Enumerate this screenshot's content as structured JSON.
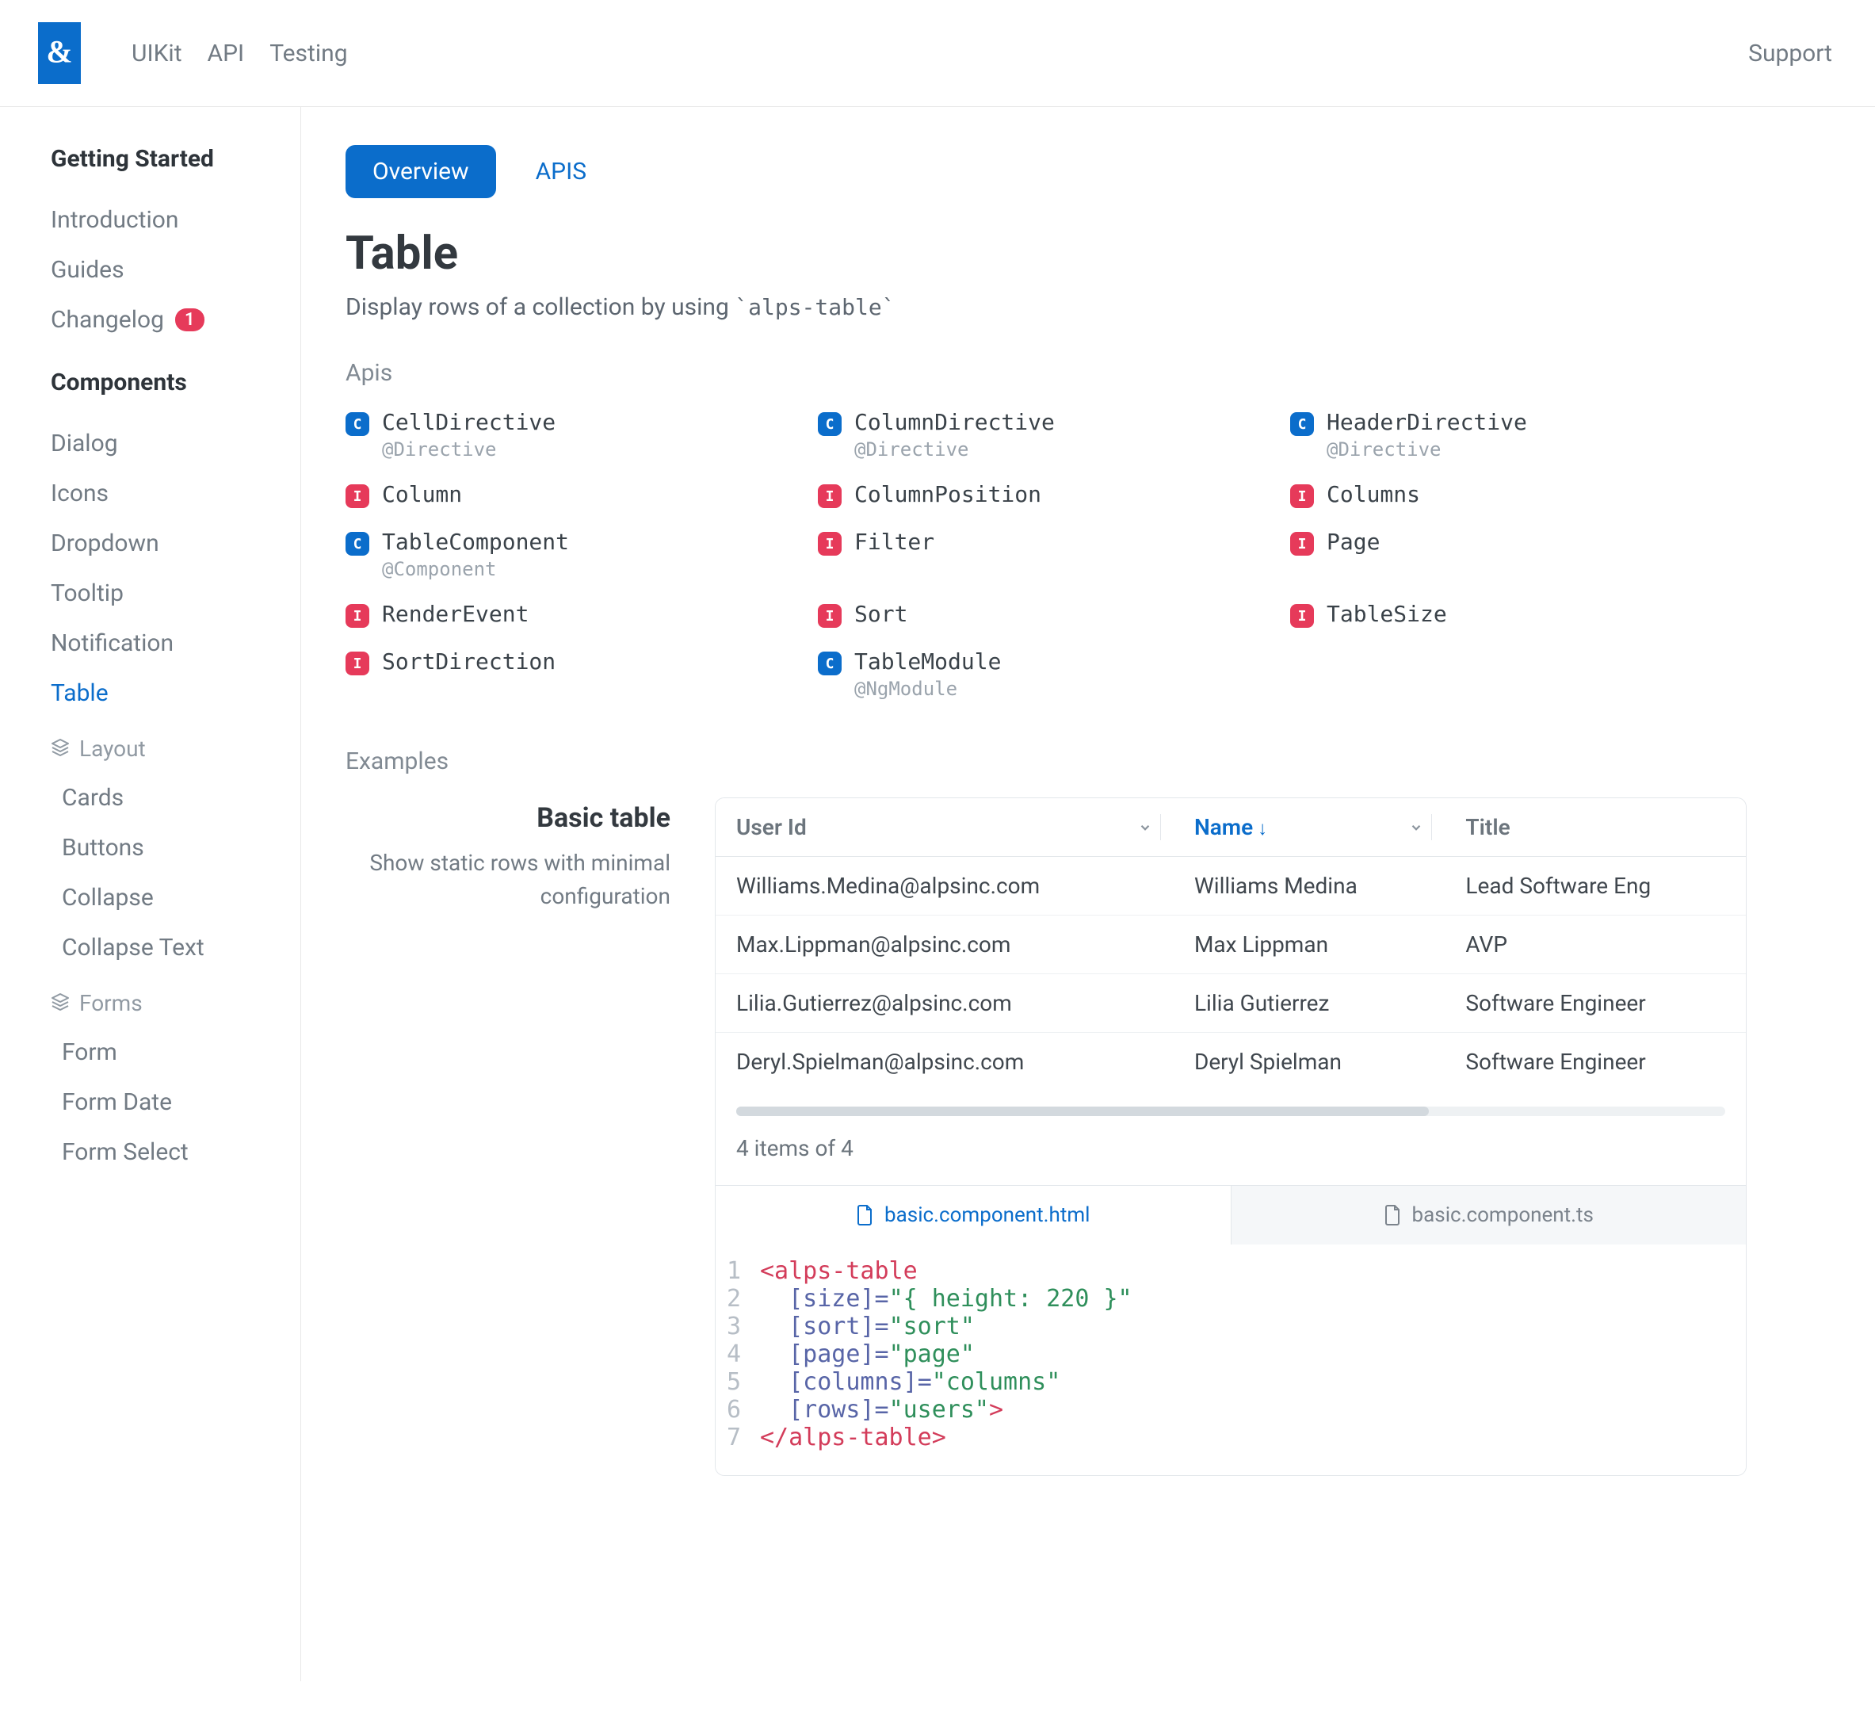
{
  "topnav": {
    "items": [
      "UIKit",
      "API",
      "Testing"
    ],
    "right": "Support"
  },
  "sidebar": {
    "sections": [
      {
        "title": "Getting Started",
        "items": [
          {
            "label": "Introduction"
          },
          {
            "label": "Guides"
          },
          {
            "label": "Changelog",
            "badge": "1"
          }
        ]
      },
      {
        "title": "Components",
        "items": [
          {
            "label": "Dialog"
          },
          {
            "label": "Icons"
          },
          {
            "label": "Dropdown"
          },
          {
            "label": "Tooltip"
          },
          {
            "label": "Notification"
          },
          {
            "label": "Table",
            "active": true
          }
        ],
        "groups": [
          {
            "label": "Layout",
            "items": [
              "Cards",
              "Buttons",
              "Collapse",
              "Collapse Text"
            ]
          },
          {
            "label": "Forms",
            "items": [
              "Form",
              "Form Date",
              "Form Select"
            ]
          }
        ]
      }
    ]
  },
  "tabs": {
    "active": "Overview",
    "other": "APIS"
  },
  "page": {
    "title": "Table",
    "desc_prefix": "Display rows of a collection by using ",
    "desc_code": "`alps-table`"
  },
  "apis": {
    "label": "Apis",
    "items": [
      {
        "tag": "C",
        "name": "CellDirective",
        "meta": "@Directive"
      },
      {
        "tag": "C",
        "name": "ColumnDirective",
        "meta": "@Directive"
      },
      {
        "tag": "C",
        "name": "HeaderDirective",
        "meta": "@Directive"
      },
      {
        "tag": "I",
        "name": "Column"
      },
      {
        "tag": "I",
        "name": "ColumnPosition"
      },
      {
        "tag": "I",
        "name": "Columns"
      },
      {
        "tag": "C",
        "name": "TableComponent",
        "meta": "@Component"
      },
      {
        "tag": "I",
        "name": "Filter"
      },
      {
        "tag": "I",
        "name": "Page"
      },
      {
        "tag": "I",
        "name": "RenderEvent"
      },
      {
        "tag": "I",
        "name": "Sort"
      },
      {
        "tag": "I",
        "name": "TableSize"
      },
      {
        "tag": "I",
        "name": "SortDirection"
      },
      {
        "tag": "C",
        "name": "TableModule",
        "meta": "@NgModule"
      }
    ]
  },
  "examples": {
    "label": "Examples",
    "basic": {
      "title": "Basic table",
      "subtitle": "Show static rows with minimal configuration",
      "columns": [
        {
          "label": "User Id",
          "chevron": true
        },
        {
          "label": "Name",
          "sorted": true,
          "arrow": "↓",
          "chevron": true
        },
        {
          "label": "Title"
        }
      ],
      "rows": [
        {
          "userid": "Williams.Medina@alpsinc.com",
          "name": "Williams Medina",
          "title": "Lead Software Eng"
        },
        {
          "userid": "Max.Lippman@alpsinc.com",
          "name": "Max Lippman",
          "title": "AVP"
        },
        {
          "userid": "Lilia.Gutierrez@alpsinc.com",
          "name": "Lilia Gutierrez",
          "title": "Software Engineer"
        },
        {
          "userid": "Deryl.Spielman@alpsinc.com",
          "name": "Deryl Spielman",
          "title": "Software Engineer"
        }
      ],
      "footer": "4 items of 4",
      "code_tabs": {
        "active": "basic.component.html",
        "other": "basic.component.ts"
      },
      "code": [
        [
          {
            "t": "tag",
            "v": "<alps-table"
          }
        ],
        [
          {
            "t": "none",
            "v": "  "
          },
          {
            "t": "attr",
            "v": "[size]"
          },
          {
            "t": "punc",
            "v": "="
          },
          {
            "t": "str",
            "v": "\"{ height: 220 }\""
          }
        ],
        [
          {
            "t": "none",
            "v": "  "
          },
          {
            "t": "attr",
            "v": "[sort]"
          },
          {
            "t": "punc",
            "v": "="
          },
          {
            "t": "str",
            "v": "\"sort\""
          }
        ],
        [
          {
            "t": "none",
            "v": "  "
          },
          {
            "t": "attr",
            "v": "[page]"
          },
          {
            "t": "punc",
            "v": "="
          },
          {
            "t": "str",
            "v": "\"page\""
          }
        ],
        [
          {
            "t": "none",
            "v": "  "
          },
          {
            "t": "attr",
            "v": "[columns]"
          },
          {
            "t": "punc",
            "v": "="
          },
          {
            "t": "str",
            "v": "\"columns\""
          }
        ],
        [
          {
            "t": "none",
            "v": "  "
          },
          {
            "t": "attr",
            "v": "[rows]"
          },
          {
            "t": "punc",
            "v": "="
          },
          {
            "t": "str",
            "v": "\"users\""
          },
          {
            "t": "tag",
            "v": ">"
          }
        ],
        [
          {
            "t": "tag",
            "v": "</alps-table>"
          }
        ]
      ]
    }
  }
}
